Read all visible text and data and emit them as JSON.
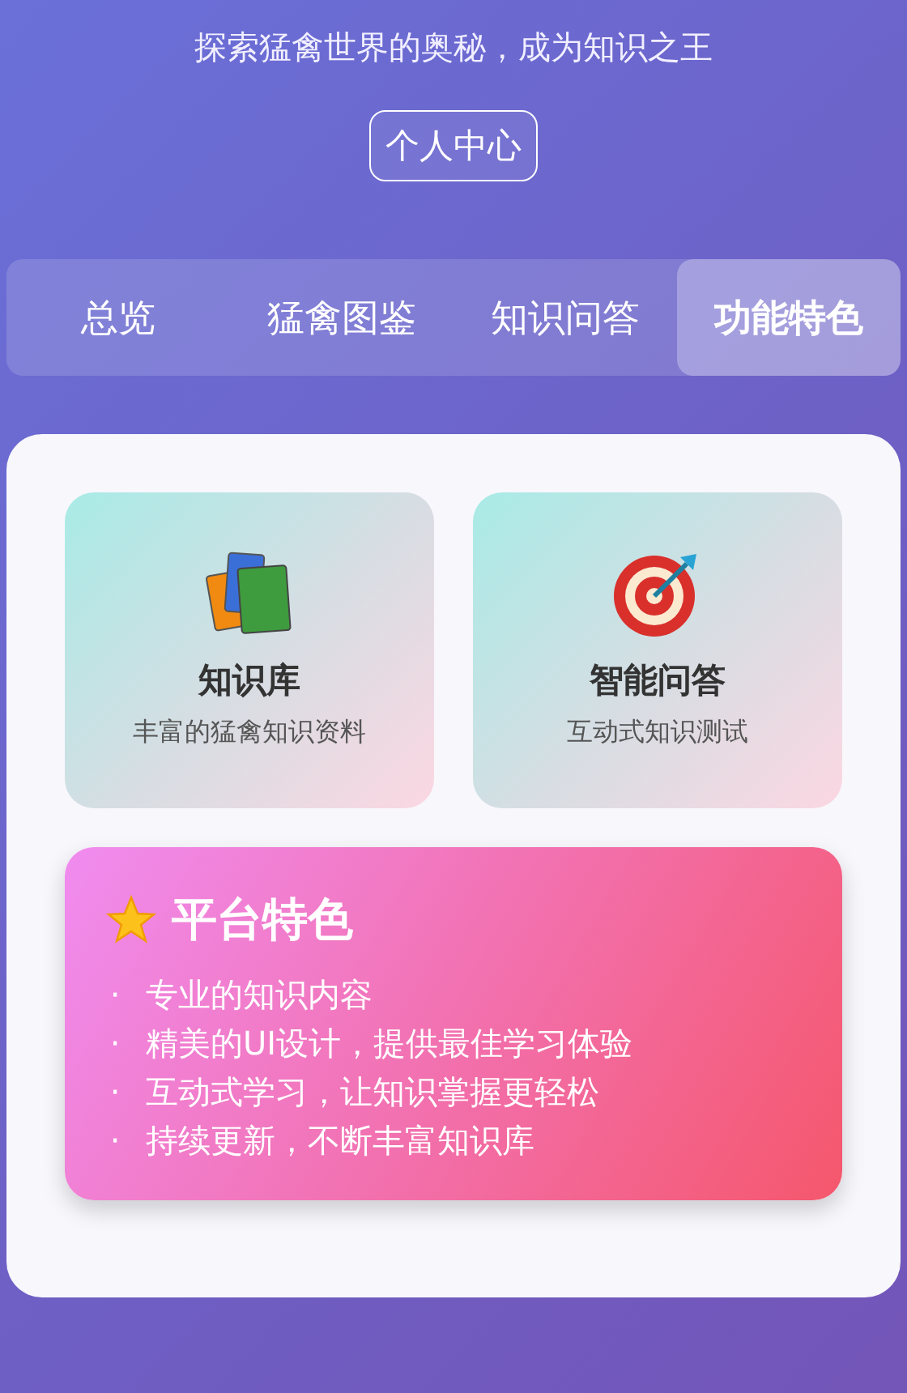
{
  "header": {
    "subtitle": "探索猛禽世界的奥秘，成为知识之王",
    "profile_button": "个人中心"
  },
  "tabs": [
    {
      "label": "总览",
      "selected": false
    },
    {
      "label": "猛禽图鉴",
      "selected": false
    },
    {
      "label": "知识问答",
      "selected": false
    },
    {
      "label": "功能特色",
      "selected": true
    }
  ],
  "features": [
    {
      "kind": "books",
      "title": "知识库",
      "description": "丰富的猛禽知识资料"
    },
    {
      "kind": "target",
      "title": "智能问答",
      "description": "互动式知识测试"
    }
  ],
  "highlights": {
    "title": "平台特色",
    "items": [
      {
        "bullet": "·",
        "text": "专业的知识内容"
      },
      {
        "bullet": "·",
        "text": "精美的UI设计，提供最佳学习体验"
      },
      {
        "bullet": "·",
        "text": "互动式学习，让知识掌握更轻松"
      },
      {
        "bullet": "·",
        "text": "持续更新，不断丰富知识库"
      }
    ]
  }
}
